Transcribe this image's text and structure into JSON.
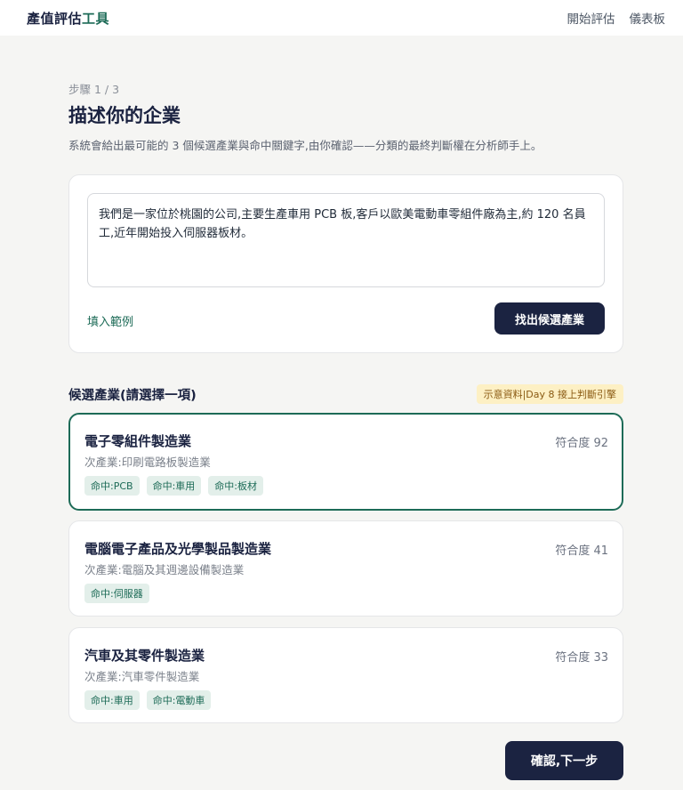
{
  "app": {
    "logo_main": "產值評估",
    "logo_accent": "工具",
    "nav": [
      "開始評估",
      "儀表板"
    ]
  },
  "header": {
    "step": "步驟 1 / 3",
    "title": "描述你的企業",
    "subtitle": "系統會給出最可能的 3 個候選產業與命中關鍵字,由你確認——分類的最終判斷權在分析師手上。"
  },
  "description": {
    "value": "我們是一家位於桃園的公司,主要生產車用 PCB 板,客戶以歐美電動車零組件廠為主,約 120 名員工,近年開始投入伺服器板材。",
    "fill_example_label": "填入範例",
    "find_button_label": "找出候選產業"
  },
  "candidates": {
    "heading": "候選產業(請選擇一項)",
    "badge": "示意資料|Day 8 接上判斷引擎",
    "items": [
      {
        "name": "電子零組件製造業",
        "score": "符合度 92",
        "sub": "次產業:印刷電路板製造業",
        "tags": [
          "命中:PCB",
          "命中:車用",
          "命中:板材"
        ],
        "selected": true
      },
      {
        "name": "電腦電子產品及光學製品製造業",
        "score": "符合度 41",
        "sub": "次產業:電腦及其週邊設備製造業",
        "tags": [
          "命中:伺服器"
        ],
        "selected": false
      },
      {
        "name": "汽車及其零件製造業",
        "score": "符合度 33",
        "sub": "次產業:汽車零件製造業",
        "tags": [
          "命中:車用",
          "命中:電動車"
        ],
        "selected": false
      }
    ]
  },
  "footer": {
    "confirm_label": "確認,下一步"
  },
  "colors": {
    "brand_navy": "#1b2341",
    "accent_green": "#1d6b57",
    "badge_bg": "#fdf0c4"
  }
}
